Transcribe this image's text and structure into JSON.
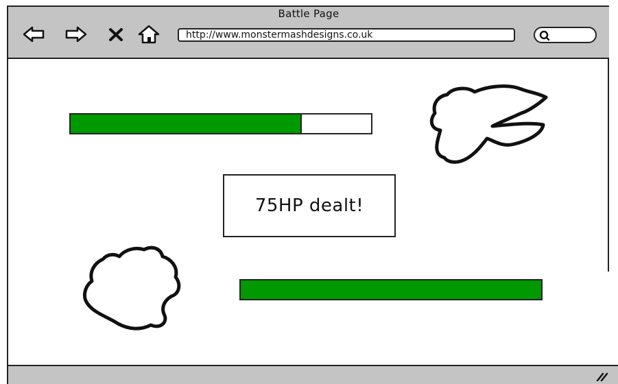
{
  "window": {
    "title": "Battle Page"
  },
  "toolbar": {
    "back_icon": "back-arrow-icon",
    "forward_icon": "forward-arrow-icon",
    "stop_icon": "close-icon",
    "home_icon": "home-icon"
  },
  "address_bar": {
    "url": "http://www.monstermashdesigns.co.uk"
  },
  "search": {
    "icon": "search-icon",
    "value": ""
  },
  "battle": {
    "enemy_hp_fraction": 0.77,
    "player_hp_fraction": 1.0,
    "hp_color": "#009900",
    "message": "75HP dealt!"
  }
}
